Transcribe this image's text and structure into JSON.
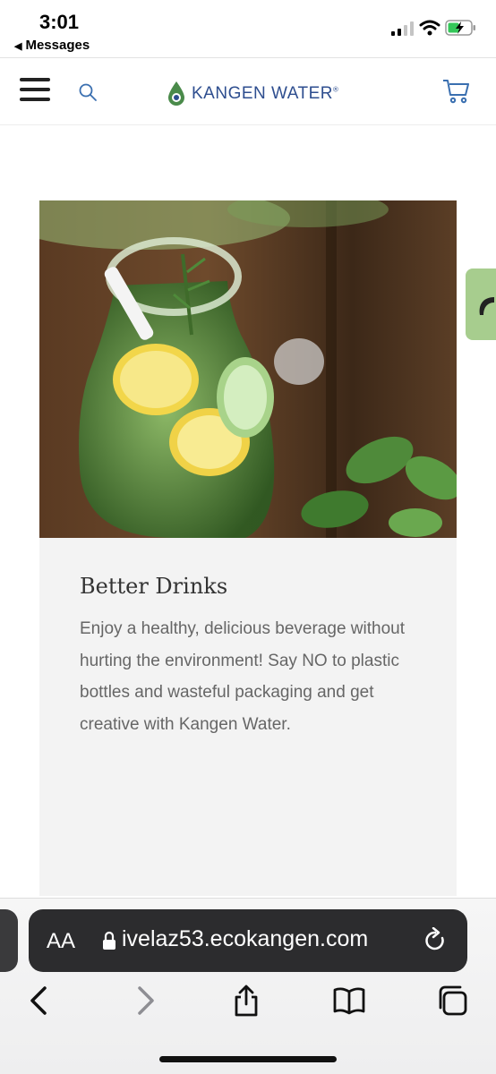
{
  "status_bar": {
    "time": "3:01",
    "back_app": "Messages"
  },
  "nav": {
    "logo_text": "KANGEN WATER",
    "logo_mark": "®"
  },
  "card": {
    "title": "Better Drinks",
    "text": "Enjoy a healthy, delicious beverage without hurting the environment! Say NO to plastic bottles and wasteful packaging and get creative with Kangen Water."
  },
  "browser": {
    "text_size_label": "AA",
    "url": "ivelaz53.ecokangen.com"
  },
  "icons": {
    "menu": "hamburger-icon",
    "search": "search-icon",
    "cart": "cart-icon",
    "back": "chevron-left-icon",
    "forward": "chevron-right-icon",
    "share": "share-icon",
    "bookmarks": "book-icon",
    "tabs": "tabs-icon",
    "reload": "reload-icon",
    "lock": "lock-icon"
  },
  "colors": {
    "brand_blue": "#2e4e8f",
    "side_tab_green": "#a7cd8e",
    "url_bar": "#2c2c2e"
  }
}
